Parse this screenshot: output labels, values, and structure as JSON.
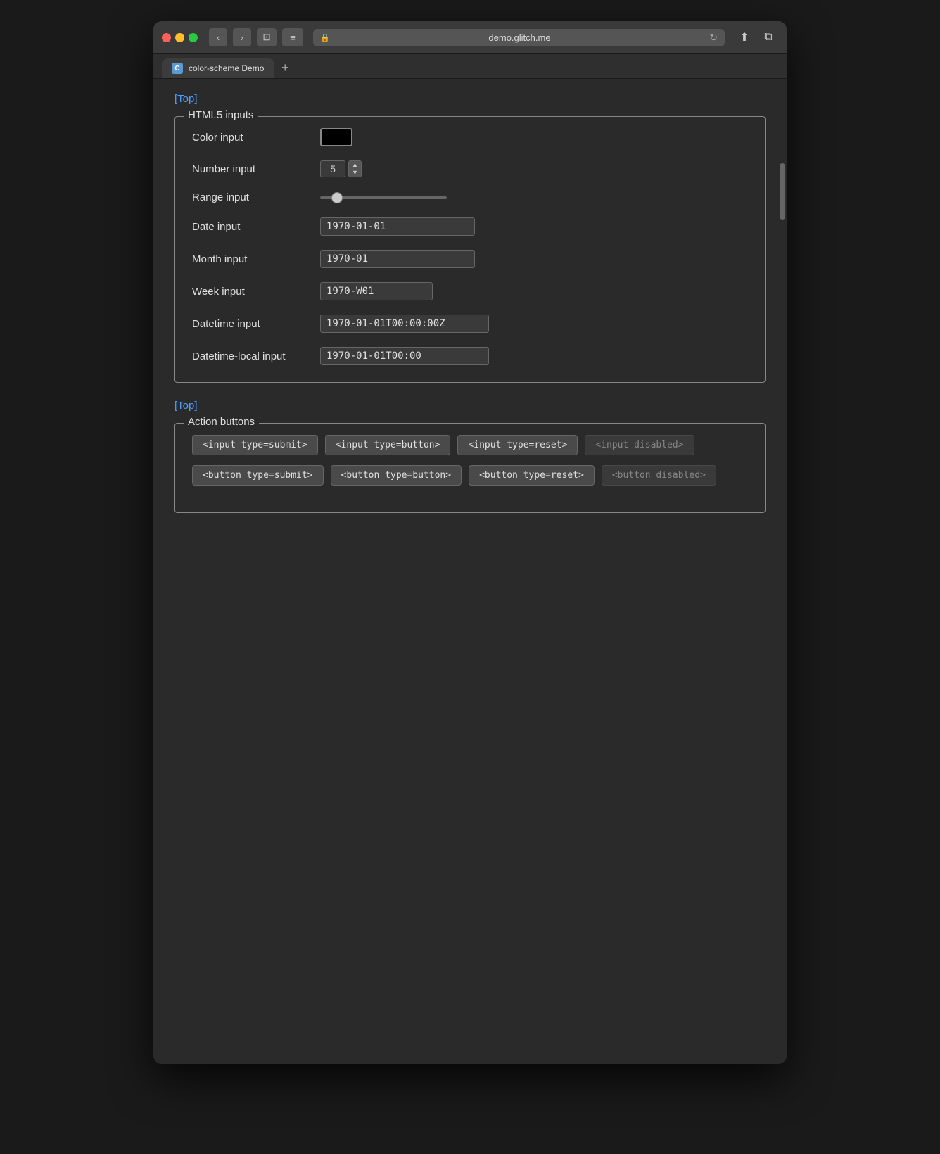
{
  "browser": {
    "url": "demo.glitch.me",
    "tab_title": "color-scheme Demo",
    "tab_favicon": "C"
  },
  "nav": {
    "back": "‹",
    "forward": "›",
    "sidebar_icon": "⊡",
    "menu_icon": "≡",
    "lock_icon": "🔒",
    "reload_icon": "↻",
    "share_icon": "⬆",
    "newwindow_icon": "⧉",
    "add_tab": "+"
  },
  "top_link": "[Top]",
  "html5_section": {
    "legend": "HTML5 inputs",
    "fields": [
      {
        "label": "Color input",
        "type": "color",
        "value": "#000000"
      },
      {
        "label": "Number input",
        "type": "number",
        "value": "5"
      },
      {
        "label": "Range input",
        "type": "range",
        "value": "10"
      },
      {
        "label": "Date input",
        "type": "date",
        "value": "1970-01-01"
      },
      {
        "label": "Month input",
        "type": "month",
        "value": "1970-01"
      },
      {
        "label": "Week input",
        "type": "week",
        "value": "1970-W01"
      },
      {
        "label": "Datetime input",
        "type": "datetime",
        "value": "1970-01-01T00:00:00Z"
      },
      {
        "label": "Datetime-local input",
        "type": "datetime-local",
        "value": "1970-01-01T00:00"
      }
    ]
  },
  "bottom_top_link": "[Top]",
  "action_section": {
    "legend": "Action buttons",
    "input_buttons": [
      {
        "label": "<input type=submit>"
      },
      {
        "label": "<input type=button>"
      },
      {
        "label": "<input type=reset>"
      },
      {
        "label": "<input disabled>",
        "disabled": true
      }
    ],
    "button_buttons": [
      {
        "label": "<button type=submit>"
      },
      {
        "label": "<button type=button>"
      },
      {
        "label": "<button type=reset>"
      },
      {
        "label": "<button disabled>",
        "disabled": true
      }
    ]
  }
}
